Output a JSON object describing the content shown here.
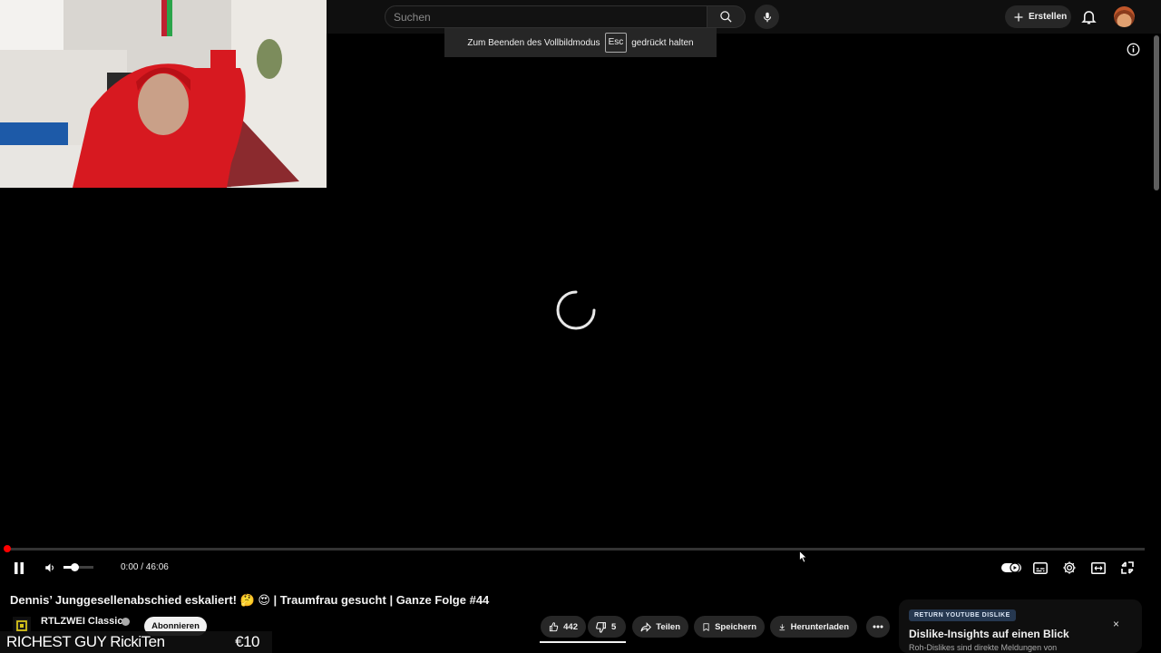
{
  "header": {
    "search": {
      "placeholder": "Suchen",
      "value": ""
    },
    "create_label": "Erstellen"
  },
  "player": {
    "fullscreen_tip": {
      "before": "Zum Beenden des Vollbildmodus",
      "key": "Esc",
      "after": "gedrückt halten"
    },
    "time": "0:00 / 46:06",
    "progress_fraction": 0.0,
    "volume_fraction": 0.35,
    "state": "loading"
  },
  "video": {
    "title": "Dennis’ Junggesellenabschied eskaliert! 🤔 😍 | Traumfrau gesucht | Ganze Folge #44",
    "channel": "RTLZWEI Classics",
    "subscribe_label": "Abonnieren"
  },
  "actions": {
    "likes": "442",
    "dislikes": "5",
    "share": "Teilen",
    "save": "Speichern",
    "download": "Herunterladen"
  },
  "overlay": {
    "left": "RICHEST GUY RickiTen",
    "right": "€10"
  },
  "rydl": {
    "badge": "RETURN YOUTUBE DISLIKE",
    "title": "Dislike-Insights auf einen Blick",
    "subtitle": "Roh-Dislikes sind direkte Meldungen von",
    "close": "×"
  },
  "colors": {
    "accent": "#ff0000",
    "background": "#000000",
    "surface": "#272727"
  }
}
